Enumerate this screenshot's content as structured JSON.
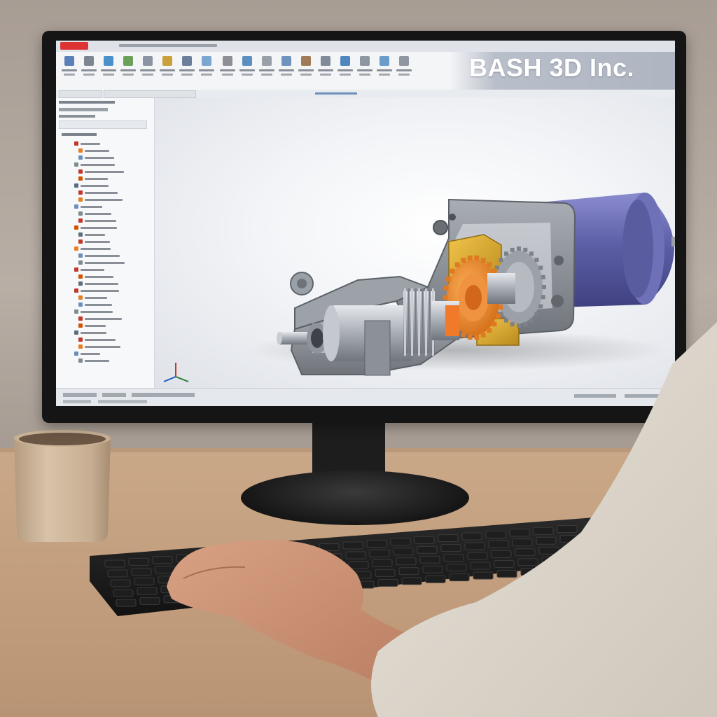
{
  "banner": {
    "brand_text": "BASH 3D Inc."
  },
  "colors": {
    "motor_housing": "#5d5fa6",
    "gear_orange": "#e88a2a",
    "gear_steel": "#a4a9b1",
    "frame_gray": "#8b8f96",
    "brass": "#d9a62a",
    "desk_wood": "#c39f7f",
    "monitor_black": "#151515"
  },
  "icons": [
    "app-logo-icon",
    "ribbon-tool-icon",
    "feature-tree-icon",
    "axis-triad-icon"
  ]
}
